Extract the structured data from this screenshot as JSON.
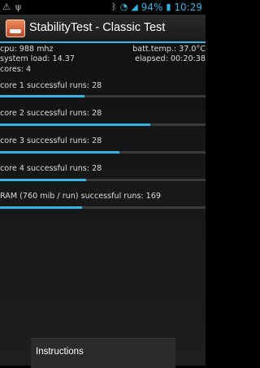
{
  "status_bar": {
    "icons_left": [
      "warning-icon",
      "usb-icon"
    ],
    "battery": "94%",
    "time": "10:29"
  },
  "action_bar": {
    "title": "StabilityTest - Classic Test"
  },
  "stats": {
    "cpu": "cpu: 988 mhz",
    "batt_temp": "batt.temp.: 37.0°C",
    "system_load": "system load: 14.37",
    "elapsed": "elapsed: 00:20:38",
    "cores": "cores: 4"
  },
  "runs": [
    {
      "label": "core 1 successful runs: 28",
      "progress": 0.41
    },
    {
      "label": "core 2 successful runs: 28",
      "progress": 0.73
    },
    {
      "label": "core 3 successful runs: 28",
      "progress": 0.58
    },
    {
      "label": "core 4 successful runs: 28",
      "progress": 0.42
    },
    {
      "label": "RAM (760 mib / run) successful runs: 169",
      "progress": 0.4
    }
  ],
  "bottom": {
    "instructions_label": "Instructions"
  },
  "colors": {
    "accent": "#33b5e5",
    "background": "#000000"
  }
}
